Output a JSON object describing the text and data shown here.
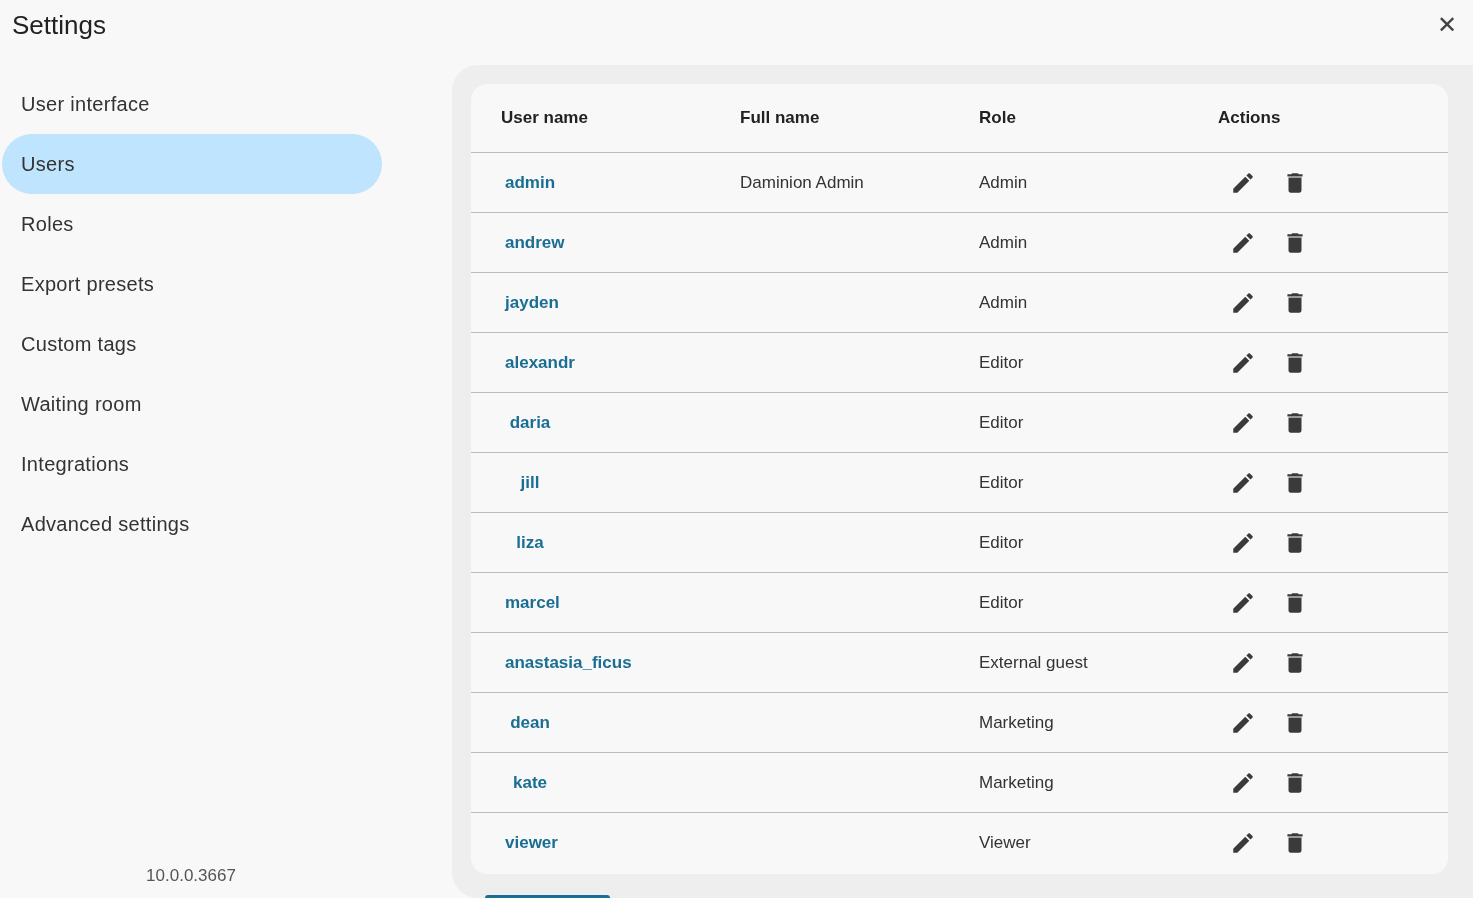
{
  "window": {
    "title": "Settings",
    "close_icon": "✕"
  },
  "sidebar": {
    "items": [
      {
        "label": "User interface",
        "selected": false
      },
      {
        "label": "Users",
        "selected": true
      },
      {
        "label": "Roles",
        "selected": false
      },
      {
        "label": "Export presets",
        "selected": false
      },
      {
        "label": "Custom tags",
        "selected": false
      },
      {
        "label": "Waiting room",
        "selected": false
      },
      {
        "label": "Integrations",
        "selected": false
      },
      {
        "label": "Advanced settings",
        "selected": false
      }
    ],
    "version": "10.0.0.3667"
  },
  "table": {
    "columns": [
      "User name",
      "Full name",
      "Role",
      "Actions"
    ],
    "rows": [
      {
        "user_name": "admin",
        "full_name": "Daminion Admin",
        "role": "Admin"
      },
      {
        "user_name": "andrew",
        "role": "Admin"
      },
      {
        "user_name": "jayden",
        "role": "Admin"
      },
      {
        "user_name": "alexandr",
        "role": "Editor"
      },
      {
        "user_name": "daria",
        "role": "Editor"
      },
      {
        "user_name": "jill",
        "role": "Editor"
      },
      {
        "user_name": "liza",
        "role": "Editor"
      },
      {
        "user_name": "marcel",
        "role": "Editor"
      },
      {
        "user_name": "anastasia_ficus",
        "role": "External guest"
      },
      {
        "user_name": "dean",
        "role": "Marketing"
      },
      {
        "user_name": "kate",
        "role": "Marketing"
      },
      {
        "user_name": "viewer",
        "role": "Viewer"
      }
    ]
  }
}
